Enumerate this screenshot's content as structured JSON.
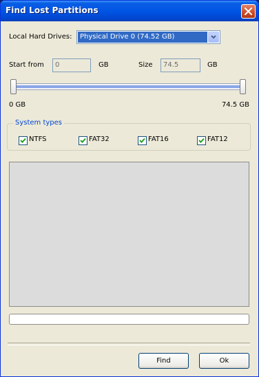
{
  "window": {
    "title": "Find Lost Partitions"
  },
  "drives": {
    "label": "Local Hard Drives:",
    "selected": "Physical Drive 0 (74.52 GB)"
  },
  "range": {
    "start_label": "Start from",
    "start_value": "0",
    "start_unit": "GB",
    "size_label": "Size",
    "size_value": "74.5",
    "size_unit": "GB",
    "min_label": "0 GB",
    "max_label": "74.5 GB",
    "slider_start_fraction": 0,
    "slider_end_fraction": 1
  },
  "system_types": {
    "title": "System types",
    "items": [
      {
        "label": "NTFS",
        "checked": true
      },
      {
        "label": "FAT32",
        "checked": true
      },
      {
        "label": "FAT16",
        "checked": true
      },
      {
        "label": "FAT12",
        "checked": true
      }
    ]
  },
  "progress": {
    "fraction": 0
  },
  "buttons": {
    "find": "Find",
    "ok": "Ok"
  },
  "colors": {
    "title_bar": "#0055e5",
    "selection": "#316ac5",
    "group_title": "#0046d5",
    "checkmark": "#21a121"
  },
  "icons": {
    "close": "close-icon",
    "dropdown": "chevron-down-icon",
    "check": "checkmark-icon"
  }
}
